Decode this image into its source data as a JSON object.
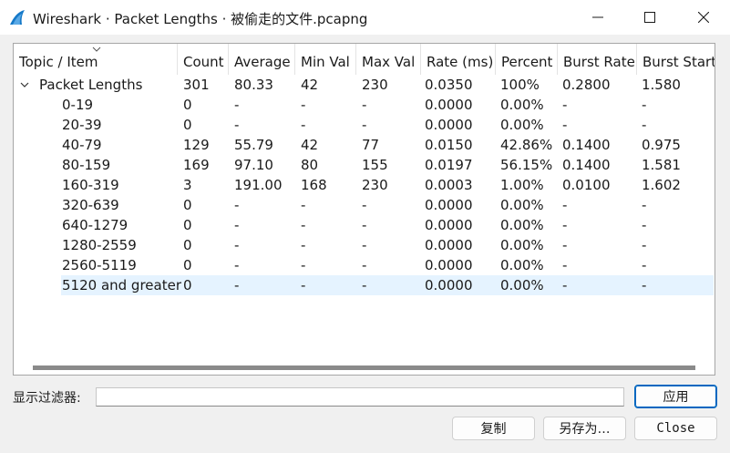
{
  "window": {
    "title": "Wireshark · Packet Lengths · 被偷走的文件.pcapng",
    "accent": "#0067c0",
    "icon": "wireshark-fin-icon"
  },
  "table": {
    "columns": [
      "Topic / Item",
      "Count",
      "Average",
      "Min Val",
      "Max Val",
      "Rate (ms)",
      "Percent",
      "Burst Rate",
      "Burst Start"
    ],
    "rows": [
      {
        "item": "Packet Lengths",
        "count": "301",
        "average": "80.33",
        "min": "42",
        "max": "230",
        "rate": "0.0350",
        "percent": "100%",
        "burst_rate": "0.2800",
        "burst_start": "1.580"
      },
      {
        "item": "0-19",
        "count": "0",
        "average": "-",
        "min": "-",
        "max": "-",
        "rate": "0.0000",
        "percent": "0.00%",
        "burst_rate": "-",
        "burst_start": "-"
      },
      {
        "item": "20-39",
        "count": "0",
        "average": "-",
        "min": "-",
        "max": "-",
        "rate": "0.0000",
        "percent": "0.00%",
        "burst_rate": "-",
        "burst_start": "-"
      },
      {
        "item": "40-79",
        "count": "129",
        "average": "55.79",
        "min": "42",
        "max": "77",
        "rate": "0.0150",
        "percent": "42.86%",
        "burst_rate": "0.1400",
        "burst_start": "0.975"
      },
      {
        "item": "80-159",
        "count": "169",
        "average": "97.10",
        "min": "80",
        "max": "155",
        "rate": "0.0197",
        "percent": "56.15%",
        "burst_rate": "0.1400",
        "burst_start": "1.581"
      },
      {
        "item": "160-319",
        "count": "3",
        "average": "191.00",
        "min": "168",
        "max": "230",
        "rate": "0.0003",
        "percent": "1.00%",
        "burst_rate": "0.0100",
        "burst_start": "1.602"
      },
      {
        "item": "320-639",
        "count": "0",
        "average": "-",
        "min": "-",
        "max": "-",
        "rate": "0.0000",
        "percent": "0.00%",
        "burst_rate": "-",
        "burst_start": "-"
      },
      {
        "item": "640-1279",
        "count": "0",
        "average": "-",
        "min": "-",
        "max": "-",
        "rate": "0.0000",
        "percent": "0.00%",
        "burst_rate": "-",
        "burst_start": "-"
      },
      {
        "item": "1280-2559",
        "count": "0",
        "average": "-",
        "min": "-",
        "max": "-",
        "rate": "0.0000",
        "percent": "0.00%",
        "burst_rate": "-",
        "burst_start": "-"
      },
      {
        "item": "2560-5119",
        "count": "0",
        "average": "-",
        "min": "-",
        "max": "-",
        "rate": "0.0000",
        "percent": "0.00%",
        "burst_rate": "-",
        "burst_start": "-"
      },
      {
        "item": "5120 and greater",
        "count": "0",
        "average": "-",
        "min": "-",
        "max": "-",
        "rate": "0.0000",
        "percent": "0.00%",
        "burst_rate": "-",
        "burst_start": "-",
        "selected": true
      }
    ]
  },
  "filter": {
    "label": "显示过滤器:",
    "value": "",
    "apply_label": "应用"
  },
  "buttons": {
    "copy": "复制",
    "save_as": "另存为…",
    "close": "Close"
  }
}
